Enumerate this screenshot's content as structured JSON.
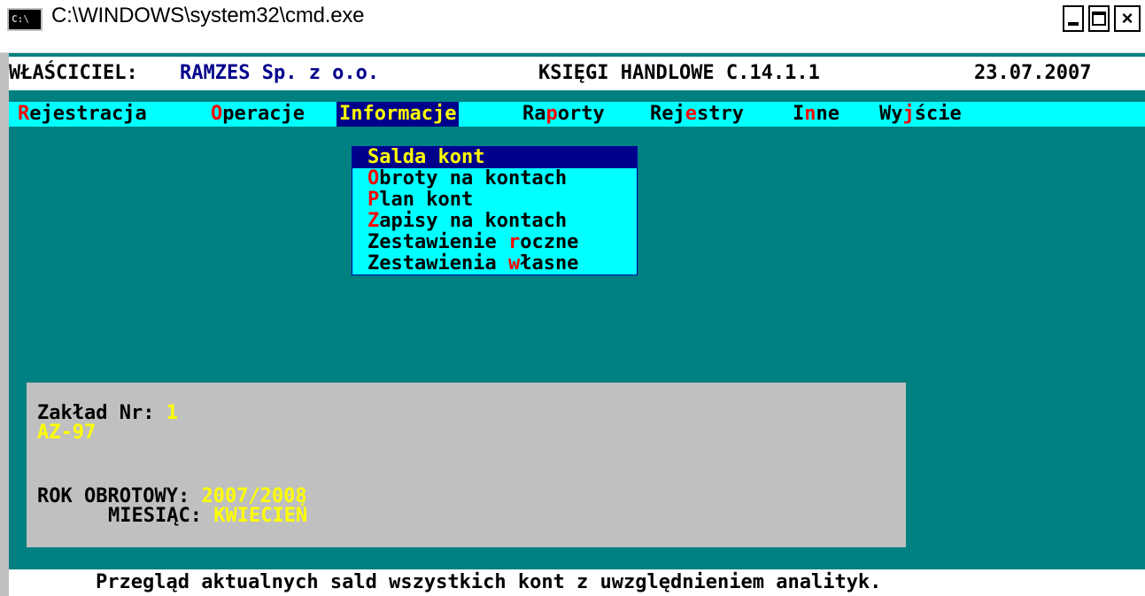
{
  "window": {
    "title": "C:\\WINDOWS\\system32\\cmd.exe",
    "icon": "console-icon",
    "icon_text": "C:\\",
    "buttons": [
      "minimize",
      "maximize",
      "close"
    ]
  },
  "header": {
    "owner_label": "WŁAŚCICIEL:",
    "owner_value": "RAMZES Sp. z o.o.",
    "program": "KSIĘGI HANDLOWE C.14.1.1",
    "date": "23.07.2007"
  },
  "menu": {
    "items": [
      {
        "pre": "",
        "hk": "R",
        "post": "ejestracja"
      },
      {
        "pre": "",
        "hk": "O",
        "post": "peracje"
      },
      {
        "pre": "",
        "hk": "I",
        "post": "nformacje"
      },
      {
        "pre": "Ra",
        "hk": "p",
        "post": "orty"
      },
      {
        "pre": "Rej",
        "hk": "e",
        "post": "stry"
      },
      {
        "pre": "I",
        "hk": "n",
        "post": "ne"
      },
      {
        "pre": "Wy",
        "hk": "j",
        "post": "ście"
      }
    ],
    "active_index": 2
  },
  "dropdown": {
    "items": [
      {
        "pre": "",
        "hk": "S",
        "post": "alda kont"
      },
      {
        "pre": "",
        "hk": "O",
        "post": "broty na kontach"
      },
      {
        "pre": "",
        "hk": "P",
        "post": "lan kont"
      },
      {
        "pre": "",
        "hk": "Z",
        "post": "apisy na kontach"
      },
      {
        "pre": "Zestawienie ",
        "hk": "r",
        "post": "oczne"
      },
      {
        "pre": "Zestawienia ",
        "hk": "w",
        "post": "łasne"
      }
    ],
    "selected_index": 0
  },
  "panel": {
    "zaklad_label": "Zakład Nr:",
    "zaklad_value": "1",
    "zaklad_name": "AZ-97",
    "rok_label": "ROK OBROTOWY:",
    "rok_value": "2007/2008",
    "miesiac_label": "MIESIĄC:",
    "miesiac_value": "KWIECIEŃ"
  },
  "status": {
    "message": "Przegląd aktualnych sald wszystkich kont z uwzględnieniem analityk."
  },
  "colors": {
    "console_bg": "#008080",
    "menu_bg": "#00ffff",
    "highlight_bg": "#00008b",
    "highlight_fg": "#ffff00",
    "hotkey": "#ff0000",
    "panel_bg": "#c0c0c0"
  }
}
